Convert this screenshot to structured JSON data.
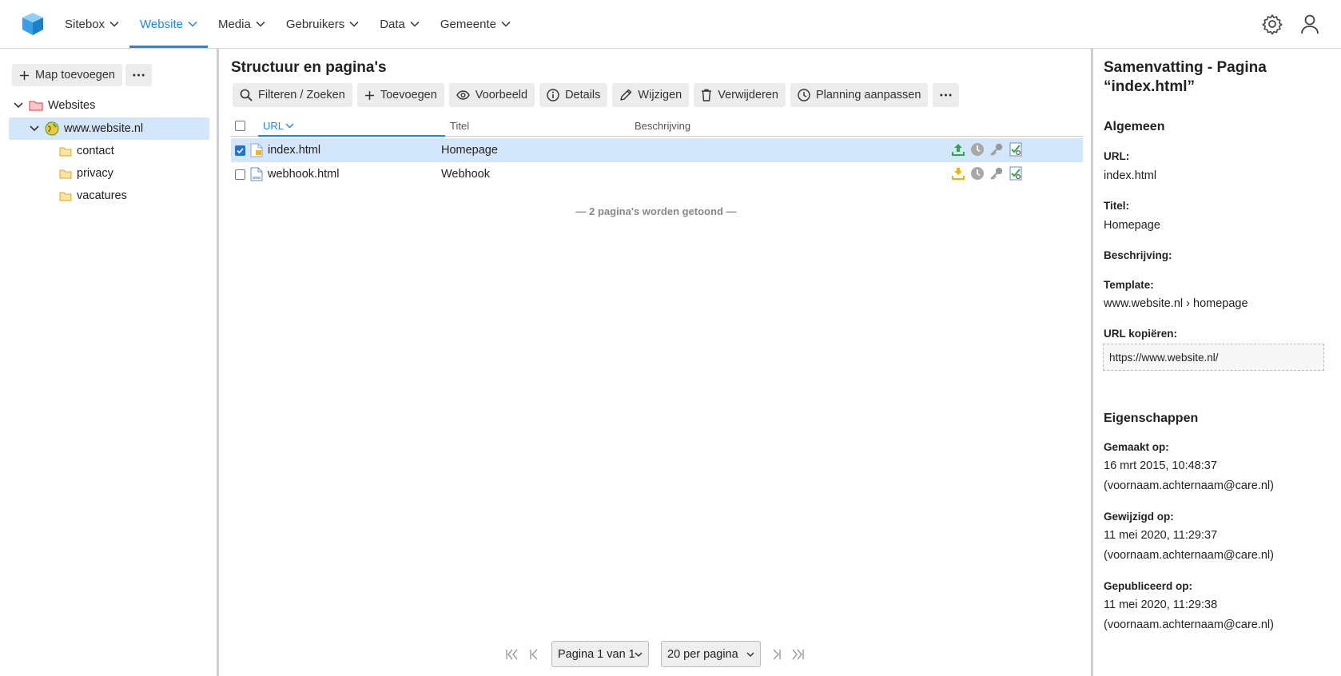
{
  "nav": {
    "items": [
      "Sitebox",
      "Website",
      "Media",
      "Gebruikers",
      "Data",
      "Gemeente"
    ],
    "active_index": 1,
    "accent": "#1e88e5"
  },
  "left": {
    "add_folder": "Map toevoegen",
    "tree": {
      "root": "Websites",
      "site": "www.website.nl",
      "folders": [
        "contact",
        "privacy",
        "vacatures"
      ]
    }
  },
  "main": {
    "title": "Structuur en pagina's",
    "toolbar": [
      "Filteren / Zoeken",
      "Toevoegen",
      "Voorbeeld",
      "Details",
      "Wijzigen",
      "Verwijderen",
      "Planning aanpassen"
    ],
    "columns": {
      "url": "URL",
      "titel": "Titel",
      "beschrijving": "Beschrijving"
    },
    "rows": [
      {
        "url": "index.html",
        "titel": "Homepage",
        "beschrijving": "",
        "selected": true,
        "status": "published"
      },
      {
        "url": "webhook.html",
        "titel": "Webhook",
        "beschrijving": "",
        "selected": false,
        "status": "unpublished"
      }
    ],
    "count_note": "— 2 pagina's worden getoond —",
    "pager": {
      "page": "Pagina 1 van 1",
      "per_page": "20 per pagina"
    }
  },
  "summary": {
    "title": "Samenvatting - Pagina “index.html”",
    "general": "Algemeen",
    "url_label": "URL:",
    "url_value": "index.html",
    "titel_label": "Titel:",
    "titel_value": "Homepage",
    "beschrijving_label": "Beschrijving:",
    "template_label": "Template:",
    "template_value": "www.website.nl › homepage",
    "copy_label": "URL kopiëren:",
    "copy_value": "https://www.website.nl/",
    "props": "Eigenschappen",
    "created_label": "Gemaakt op:",
    "created_date": "16 mrt 2015, 10:48:37",
    "created_by": "(voornaam.achternaam@care.nl)",
    "modified_label": "Gewijzigd op:",
    "modified_date": "11 mei 2020, 11:29:37",
    "modified_by": "(voornaam.achternaam@care.nl)",
    "published_label": "Gepubliceerd op:",
    "published_date": "11 mei 2020, 11:29:38",
    "published_by": "(voornaam.achternaam@care.nl)"
  }
}
